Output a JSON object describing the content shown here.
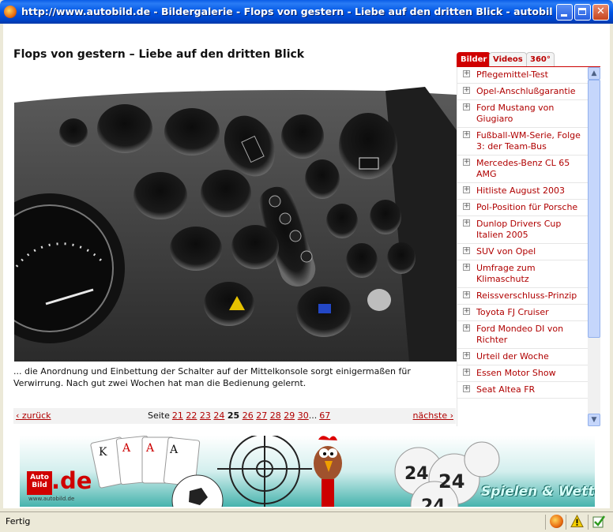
{
  "window": {
    "title": "http://www.autobild.de - Bildergalerie - Flops von gestern - Liebe auf den dritten Blick - autobild.de - Moz..."
  },
  "gallery": {
    "title": "Flops von gestern – Liebe auf den dritten Blick",
    "caption": "... die Anordnung und Einbettung der Schalter auf der Mittelkonsole sorgt einigermaßen für Verwirrung. Nach gut zwei Wochen hat man die Bedienung gelernt.",
    "pager": {
      "prev_label": "‹ zurück",
      "next_label": "nächste ›",
      "prefix": "Seite",
      "pages_before": [
        "21",
        "22",
        "23",
        "24"
      ],
      "current": "25",
      "pages_after": [
        "26",
        "27",
        "28",
        "29",
        "30"
      ],
      "ellipsis": "...",
      "last": "67"
    }
  },
  "sidebar": {
    "tabs": [
      "Bilder",
      "Videos",
      "360°"
    ],
    "active_tab": "Bilder",
    "items": [
      "Pflegemittel-Test",
      "Opel-Anschlußgarantie",
      "Ford Mustang von Giugiaro",
      "Fußball-WM-Serie, Folge 3: der Team-Bus",
      "Mercedes-Benz CL 65 AMG",
      "Hitliste August 2003",
      "Pol-Position für Porsche",
      "Dunlop Drivers Cup Italien 2005",
      "SUV von Opel",
      "Umfrage zum Klimaschutz",
      "Reissverschluss-Prinzip",
      "Toyota FJ Cruiser",
      "Ford Mondeo DI von Richter",
      "Urteil der Woche",
      "Essen Motor Show",
      "Seat Altea FR"
    ]
  },
  "banner": {
    "logo_top": "Auto Bild",
    "logo_de": ".de",
    "logo_url": "www.autobild.de",
    "slogan": "Spielen & Wetten"
  },
  "status": {
    "text": "Fertig"
  },
  "colors": {
    "accent": "#d00000",
    "link": "#b00000",
    "titlebar": "#0055e5"
  }
}
